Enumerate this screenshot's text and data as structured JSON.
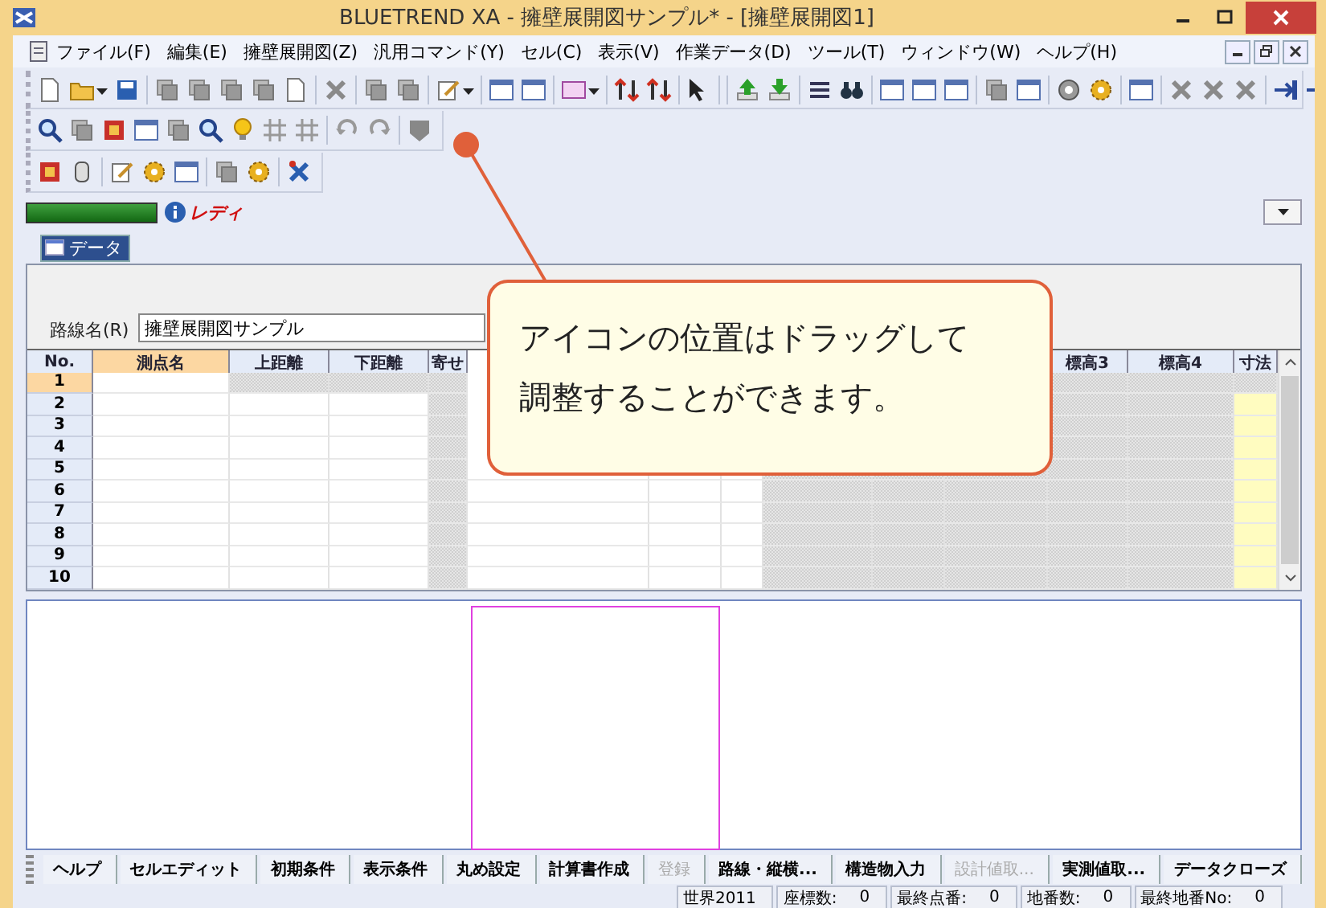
{
  "window": {
    "title": "BLUETREND XA - 擁壁展開図サンプル* - [擁壁展開図1]"
  },
  "menu": [
    "ファイル(F)",
    "編集(E)",
    "擁壁展開図(Z)",
    "汎用コマンド(Y)",
    "セル(C)",
    "表示(V)",
    "作業データ(D)",
    "ツール(T)",
    "ウィンドウ(W)",
    "ヘルプ(H)"
  ],
  "status_strip": {
    "level": 1,
    "message": "レディ"
  },
  "data_tab": {
    "label": "データ",
    "selected": true
  },
  "route_name": {
    "label": "路線名(R)",
    "value": "擁壁展開図サンプル"
  },
  "grid": {
    "columns": [
      {
        "label": "No.",
        "kind": "rowhead",
        "selected": false
      },
      {
        "label": "測点名",
        "kind": "plain",
        "selected": true
      },
      {
        "label": "上距離",
        "kind": "plain",
        "selected": false
      },
      {
        "label": "下距離",
        "kind": "plain",
        "selected": false
      },
      {
        "label": "寄せ",
        "kind": "hatched",
        "selected": false
      },
      {
        "kind": "plain"
      },
      {
        "kind": "plain"
      },
      {
        "kind": "plain"
      },
      {
        "kind": "hatched"
      },
      {
        "kind": "hatched"
      },
      {
        "kind": "hatched"
      },
      {
        "label": "標高3",
        "kind": "hatched",
        "selected": false
      },
      {
        "label": "標高4",
        "kind": "hatched",
        "selected": false
      },
      {
        "label": "寸法",
        "kind": "highlight",
        "selected": false
      }
    ],
    "rows": [
      {
        "label": "1",
        "selected": true,
        "hatched": true
      },
      {
        "label": "2",
        "selected": false,
        "hatched": false
      },
      {
        "label": "3",
        "selected": false,
        "hatched": false
      },
      {
        "label": "4",
        "selected": false,
        "hatched": false
      },
      {
        "label": "5",
        "selected": false,
        "hatched": false
      },
      {
        "label": "6",
        "selected": false,
        "hatched": false
      },
      {
        "label": "7",
        "selected": false,
        "hatched": false
      },
      {
        "label": "8",
        "selected": false,
        "hatched": false
      },
      {
        "label": "9",
        "selected": false,
        "hatched": false
      },
      {
        "label": "10",
        "selected": false,
        "hatched": false
      }
    ]
  },
  "callout": {
    "lines": [
      "アイコンの位置はドラッグして",
      "調整することができます。"
    ]
  },
  "bottom_tabs": [
    {
      "label": "ヘルプ",
      "disabled": false
    },
    {
      "label": "セルエディット",
      "disabled": false
    },
    {
      "label": "初期条件",
      "disabled": false
    },
    {
      "label": "表示条件",
      "disabled": false
    },
    {
      "label": "丸め設定",
      "disabled": false
    },
    {
      "label": "計算書作成",
      "disabled": false
    },
    {
      "label": "登録",
      "disabled": true
    },
    {
      "label": "路線・縦横...",
      "disabled": false
    },
    {
      "label": "構造物入力",
      "disabled": false
    },
    {
      "label": "設計値取...",
      "disabled": true
    },
    {
      "label": "実測値取...",
      "disabled": false
    },
    {
      "label": "データクローズ",
      "disabled": false
    }
  ],
  "status_bar": [
    {
      "label": "世界2011"
    },
    {
      "label": "座標数:",
      "value": "0"
    },
    {
      "label": "最終点番:",
      "value": "0"
    },
    {
      "label": "地番数:",
      "value": "0"
    },
    {
      "label": "最終地番No:",
      "value": "0"
    }
  ]
}
